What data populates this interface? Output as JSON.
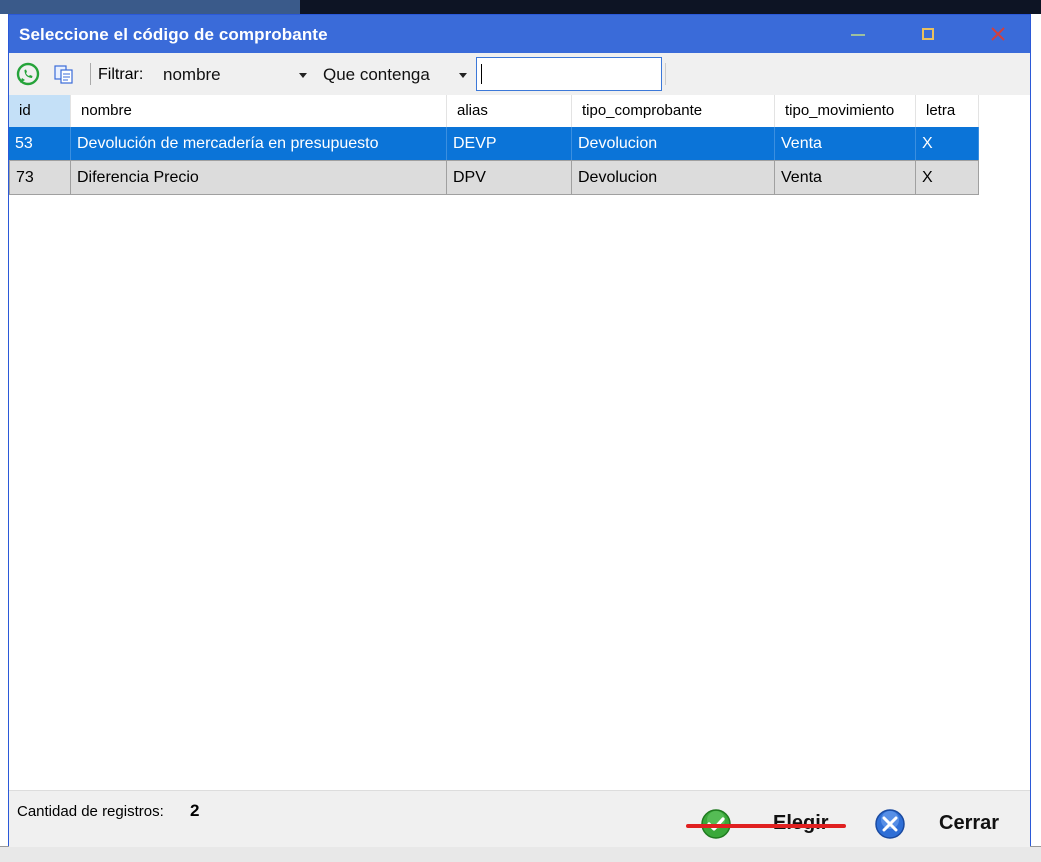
{
  "dialog": {
    "title": "Seleccione el código de comprobante"
  },
  "toolbar": {
    "filter_label": "Filtrar:",
    "filter_field": "nombre",
    "filter_mode": "Que contenga",
    "search_value": ""
  },
  "grid": {
    "columns": [
      "id",
      "nombre",
      "alias",
      "tipo_comprobante",
      "tipo_movimiento",
      "letra"
    ],
    "rows": [
      {
        "id": "53",
        "nombre": "Devolución de mercadería en presupuesto",
        "alias": "DEVP",
        "tipo_comprobante": "Devolucion",
        "tipo_movimiento": "Venta",
        "letra": "X"
      },
      {
        "id": "73",
        "nombre": "Diferencia Precio",
        "alias": "DPV",
        "tipo_comprobante": "Devolucion",
        "tipo_movimiento": "Venta",
        "letra": "X"
      }
    ]
  },
  "footer": {
    "count_label": "Cantidad de registros:",
    "count_value": "2",
    "elegir_label": "Elegir",
    "cerrar_label": "Cerrar"
  },
  "colors": {
    "titlebar": "#3a6bd9",
    "selected_row": "#0b74d8",
    "underline": "#e02020"
  }
}
